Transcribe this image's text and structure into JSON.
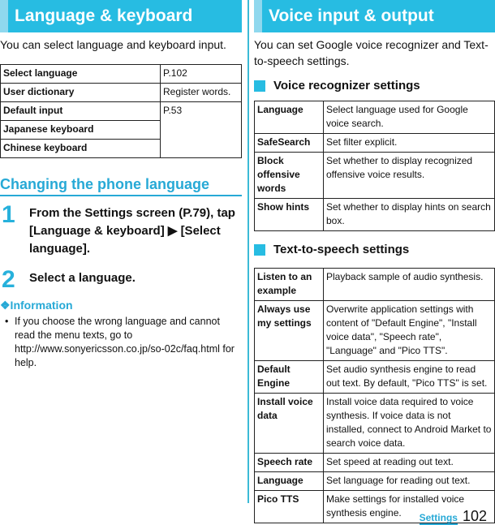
{
  "left": {
    "header": "Language & keyboard",
    "intro": "You can select language and keyboard input.",
    "table": [
      {
        "key": "Select language",
        "value": "P.102"
      },
      {
        "key": "User dictionary",
        "value": "Register words."
      },
      {
        "key": "Default input",
        "value": "P.53"
      },
      {
        "key": "Japanese keyboard",
        "value": ""
      },
      {
        "key": "Chinese keyboard",
        "value": ""
      }
    ],
    "subheader": "Changing the phone language",
    "steps": [
      {
        "num": "1",
        "text": "From the Settings screen (P.79), tap [Language & keyboard] ▶ [Select language]."
      },
      {
        "num": "2",
        "text": "Select a language."
      }
    ],
    "info_title": "❖Information",
    "info_text": "If you choose the wrong language and cannot read the menu texts, go to http://www.sonyericsson.co.jp/so-02c/faq.html for help."
  },
  "right": {
    "header": "Voice input & output",
    "intro": "You can set Google voice recognizer and Text-to-speech settings.",
    "voice_section": "Voice recognizer settings",
    "voice_table": [
      {
        "key": "Language",
        "value": "Select language used for Google voice search."
      },
      {
        "key": "SafeSearch",
        "value": "Set filter explicit."
      },
      {
        "key": "Block offensive words",
        "value": "Set whether to display recognized offensive voice results."
      },
      {
        "key": "Show hints",
        "value": "Set whether to display hints on search box."
      }
    ],
    "tts_section": "Text-to-speech settings",
    "tts_table": [
      {
        "key": "Listen to an example",
        "value": "Playback sample of audio synthesis."
      },
      {
        "key": "Always use my settings",
        "value": "Overwrite application settings with content of \"Default Engine\", \"Install voice data\", \"Speech rate\", \"Language\" and \"Pico TTS\"."
      },
      {
        "key": "Default Engine",
        "value": "Set audio synthesis engine to read out text. By default, \"Pico TTS\" is set."
      },
      {
        "key": "Install voice data",
        "value": "Install voice data required to voice synthesis. If voice data is not installed, connect to Android Market to search voice data."
      },
      {
        "key": "Speech rate",
        "value": "Set speed at reading out text."
      },
      {
        "key": "Language",
        "value": "Set language for reading out text."
      },
      {
        "key": "Pico TTS",
        "value": "Make settings for installed voice synthesis engine."
      }
    ]
  },
  "footer": {
    "section": "Settings",
    "page": "102"
  },
  "colors": {
    "accent": "#27bce2",
    "accent_light": "#8fd8ee",
    "accent_text": "#27a9d6"
  }
}
